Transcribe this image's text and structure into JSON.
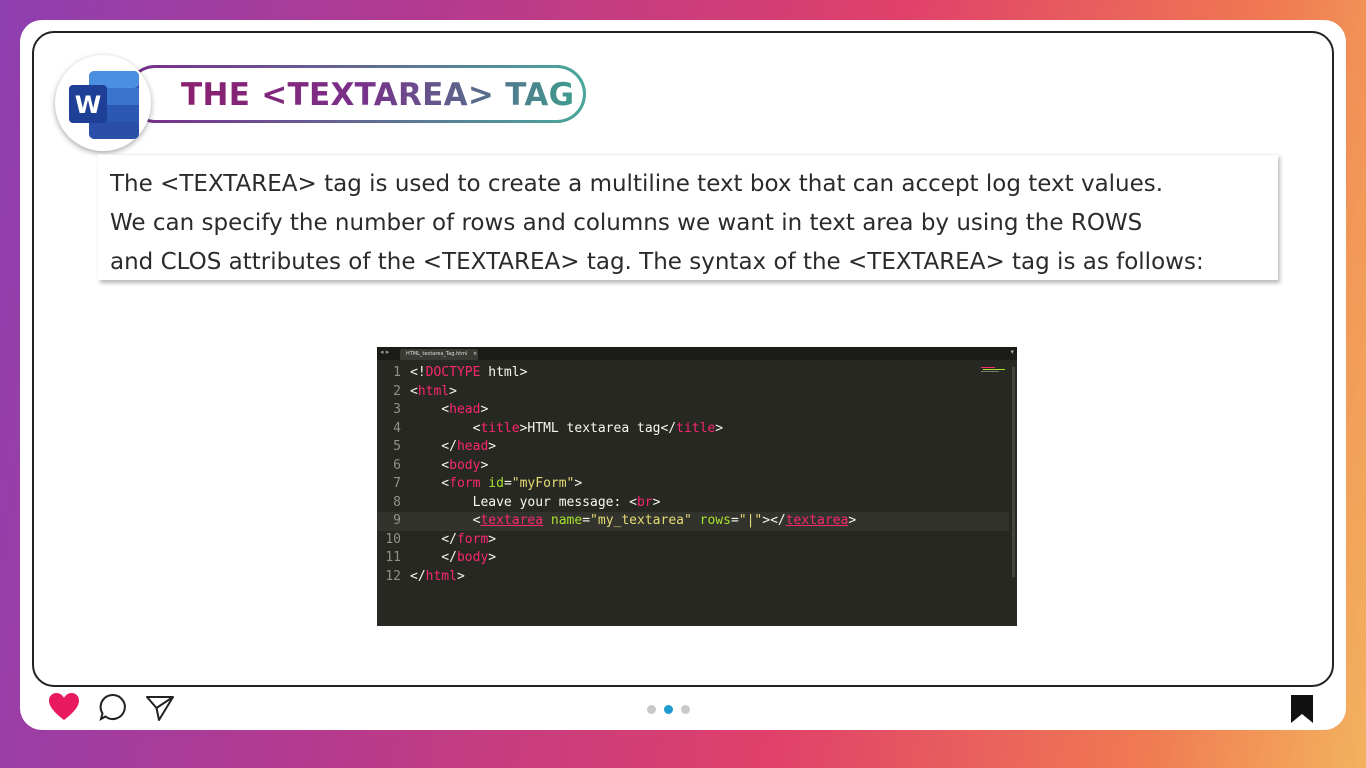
{
  "slide": {
    "title": "THE <TEXTAREA> TAG",
    "logo_letter": "W",
    "description_lines": [
      "The <TEXTAREA> tag is used to create a multiline text box that can accept log text values.",
      "We can specify the number of rows and columns we want in text area by using the ROWS",
      "and CLOS attributes of the <TEXTAREA> tag. The syntax of the <TEXTAREA> tag is as follows:"
    ]
  },
  "editor": {
    "tab_label": "HTML_textarea_Tag.html",
    "tab_close": "×",
    "nav_arrows": "◂ ▸",
    "menu_glyph": "▾",
    "line_numbers": [
      "1",
      "2",
      "3",
      "4",
      "5",
      "6",
      "7",
      "8",
      "9",
      "10",
      "11",
      "12"
    ]
  },
  "bottom_bar": {
    "pager": {
      "total": 3,
      "active_index": 1
    },
    "icons": [
      "heart-icon",
      "comment-icon",
      "send-icon",
      "bookmark-icon"
    ],
    "heart_color": "#e8195e"
  }
}
